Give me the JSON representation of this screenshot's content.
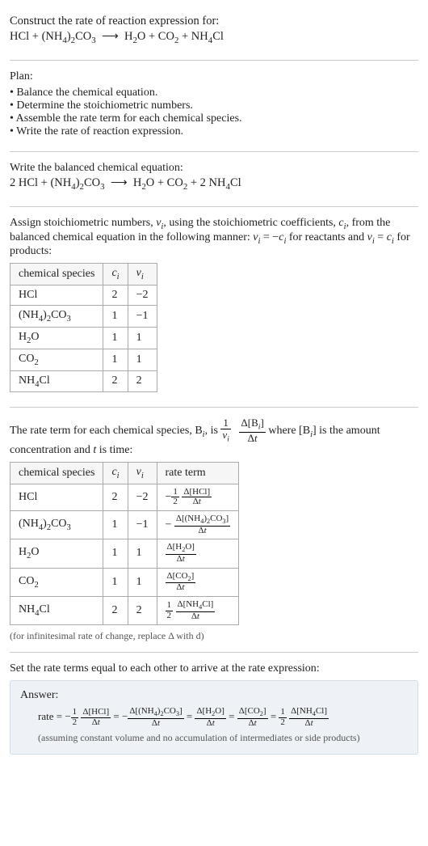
{
  "intro": {
    "title": "Construct the rate of reaction expression for:",
    "equation_html": "HCl + (NH<span class='sub'>4</span>)<span class='sub'>2</span>CO<span class='sub'>3</span>&nbsp; ⟶ &nbsp;H<span class='sub'>2</span>O + CO<span class='sub'>2</span> + NH<span class='sub'>4</span>Cl"
  },
  "plan": {
    "heading": "Plan:",
    "items": [
      "Balance the chemical equation.",
      "Determine the stoichiometric numbers.",
      "Assemble the rate term for each chemical species.",
      "Write the rate of reaction expression."
    ]
  },
  "balanced": {
    "heading": "Write the balanced chemical equation:",
    "equation_html": "2 HCl + (NH<span class='sub'>4</span>)<span class='sub'>2</span>CO<span class='sub'>3</span>&nbsp; ⟶ &nbsp;H<span class='sub'>2</span>O + CO<span class='sub'>2</span> + 2 NH<span class='sub'>4</span>Cl"
  },
  "assign": {
    "text_html": "Assign stoichiometric numbers, <span class='italic-var'>ν<span class='sub'>i</span></span>, using the stoichiometric coefficients, <span class='italic-var'>c<span class='sub'>i</span></span>, from the balanced chemical equation in the following manner: <span class='italic-var'>ν<span class='sub'>i</span></span> = −<span class='italic-var'>c<span class='sub'>i</span></span> for reactants and <span class='italic-var'>ν<span class='sub'>i</span></span> = <span class='italic-var'>c<span class='sub'>i</span></span> for products:",
    "headers": {
      "species": "chemical species",
      "ci_html": "<span class='italic-var'>c<span class='sub'>i</span></span>",
      "vi_html": "<span class='italic-var'>ν<span class='sub'>i</span></span>"
    },
    "rows": [
      {
        "sp_html": "HCl",
        "ci": "2",
        "vi": "−2"
      },
      {
        "sp_html": "(NH<span class='sub'>4</span>)<span class='sub'>2</span>CO<span class='sub'>3</span>",
        "ci": "1",
        "vi": "−1"
      },
      {
        "sp_html": "H<span class='sub'>2</span>O",
        "ci": "1",
        "vi": "1"
      },
      {
        "sp_html": "CO<span class='sub'>2</span>",
        "ci": "1",
        "vi": "1"
      },
      {
        "sp_html": "NH<span class='sub'>4</span>Cl",
        "ci": "2",
        "vi": "2"
      }
    ]
  },
  "rateterm": {
    "text_before_html": "The rate term for each chemical species, B<span class='sub italic-var'>i</span>, is ",
    "text_after_html": " where [B<span class='sub italic-var'>i</span>] is the amount concentration and <span class='italic-var'>t</span> is time:",
    "outer_num": "1",
    "outer_den_html": "<span class='italic-var'>ν<span class='sub'>i</span></span>",
    "inner_num_html": "Δ[B<span class='sub italic-var'>i</span>]",
    "inner_den_html": "Δ<span class='italic-var'>t</span>",
    "headers": {
      "species": "chemical species",
      "ci_html": "<span class='italic-var'>c<span class='sub'>i</span></span>",
      "vi_html": "<span class='italic-var'>ν<span class='sub'>i</span></span>",
      "rate": "rate term"
    },
    "rows": [
      {
        "sp_html": "HCl",
        "ci": "2",
        "vi": "−2",
        "prefix_html": "−<span class='frac sfrac'><span class='num'>1</span><span class='den'>2</span></span> ",
        "dnum_html": "Δ[HCl]",
        "dden_html": "Δ<span class='italic-var'>t</span>"
      },
      {
        "sp_html": "(NH<span class='sub'>4</span>)<span class='sub'>2</span>CO<span class='sub'>3</span>",
        "ci": "1",
        "vi": "−1",
        "prefix_html": "−",
        "dnum_html": "Δ[(NH<span class='sub'>4</span>)<span class='sub'>2</span>CO<span class='sub'>3</span>]",
        "dden_html": "Δ<span class='italic-var'>t</span>"
      },
      {
        "sp_html": "H<span class='sub'>2</span>O",
        "ci": "1",
        "vi": "1",
        "prefix_html": "",
        "dnum_html": "Δ[H<span class='sub'>2</span>O]",
        "dden_html": "Δ<span class='italic-var'>t</span>"
      },
      {
        "sp_html": "CO<span class='sub'>2</span>",
        "ci": "1",
        "vi": "1",
        "prefix_html": "",
        "dnum_html": "Δ[CO<span class='sub'>2</span>]",
        "dden_html": "Δ<span class='italic-var'>t</span>"
      },
      {
        "sp_html": "NH<span class='sub'>4</span>Cl",
        "ci": "2",
        "vi": "2",
        "prefix_html": "<span class='frac sfrac'><span class='num'>1</span><span class='den'>2</span></span> ",
        "dnum_html": "Δ[NH<span class='sub'>4</span>Cl]",
        "dden_html": "Δ<span class='italic-var'>t</span>"
      }
    ],
    "note": "(for infinitesimal rate of change, replace Δ with d)"
  },
  "final": {
    "heading": "Set the rate terms equal to each other to arrive at the rate expression:"
  },
  "answer": {
    "title": "Answer:",
    "lead": "rate = ",
    "terms": [
      {
        "prefix_html": "−<span class='frac sfrac'><span class='num'>1</span><span class='den'>2</span></span> ",
        "num_html": "Δ[HCl]",
        "den_html": "Δ<span class='italic-var'>t</span>"
      },
      {
        "prefix_html": "−",
        "num_html": "Δ[(NH<span class='sub'>4</span>)<span class='sub'>2</span>CO<span class='sub'>3</span>]",
        "den_html": "Δ<span class='italic-var'>t</span>"
      },
      {
        "prefix_html": "",
        "num_html": "Δ[H<span class='sub'>2</span>O]",
        "den_html": "Δ<span class='italic-var'>t</span>"
      },
      {
        "prefix_html": "",
        "num_html": "Δ[CO<span class='sub'>2</span>]",
        "den_html": "Δ<span class='italic-var'>t</span>"
      },
      {
        "prefix_html": "<span class='frac sfrac'><span class='num'>1</span><span class='den'>2</span></span> ",
        "num_html": "Δ[NH<span class='sub'>4</span>Cl]",
        "den_html": "Δ<span class='italic-var'>t</span>"
      }
    ],
    "note": "(assuming constant volume and no accumulation of intermediates or side products)"
  }
}
